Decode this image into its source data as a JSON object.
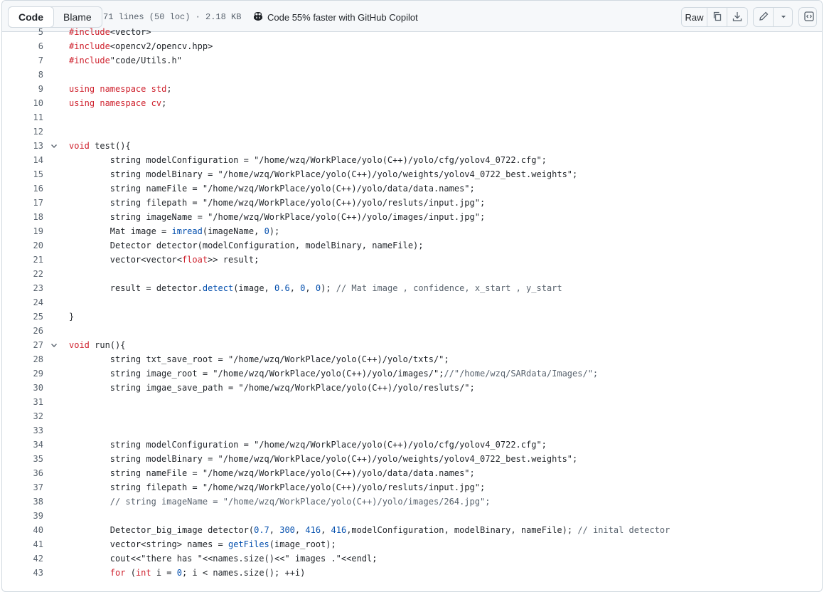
{
  "toolbar": {
    "tab_code": "Code",
    "tab_blame": "Blame",
    "file_info": "71 lines (50 loc) · 2.18 KB",
    "copilot_text": "Code 55% faster with GitHub Copilot",
    "raw_label": "Raw"
  },
  "colors": {
    "keyword": "#cf222e",
    "function": "#0550ae",
    "comment": "#59636e",
    "line_number": "#59636e"
  },
  "code_lines": [
    {
      "n": "5",
      "t": "#include<vector>"
    },
    {
      "n": "6",
      "t": "#include<opencv2/opencv.hpp>"
    },
    {
      "n": "7",
      "t": "#include\"code/Utils.h\""
    },
    {
      "n": "8",
      "t": ""
    },
    {
      "n": "9",
      "t": "using namespace std;"
    },
    {
      "n": "10",
      "t": "using namespace cv;"
    },
    {
      "n": "11",
      "t": ""
    },
    {
      "n": "12",
      "t": ""
    },
    {
      "n": "13",
      "t": "void test(){",
      "fold": true
    },
    {
      "n": "14",
      "t": "        string modelConfiguration = \"/home/wzq/WorkPlace/yolo(C++)/yolo/cfg/yolov4_0722.cfg\";"
    },
    {
      "n": "15",
      "t": "        string modelBinary = \"/home/wzq/WorkPlace/yolo(C++)/yolo/weights/yolov4_0722_best.weights\";"
    },
    {
      "n": "16",
      "t": "        string nameFile = \"/home/wzq/WorkPlace/yolo(C++)/yolo/data/data.names\";"
    },
    {
      "n": "17",
      "t": "        string filepath = \"/home/wzq/WorkPlace/yolo(C++)/yolo/resluts/input.jpg\";"
    },
    {
      "n": "18",
      "t": "        string imageName = \"/home/wzq/WorkPlace/yolo(C++)/yolo/images/input.jpg\";"
    },
    {
      "n": "19",
      "t": "        Mat image = imread(imageName, 0);"
    },
    {
      "n": "20",
      "t": "        Detector detector(modelConfiguration, modelBinary, nameFile);"
    },
    {
      "n": "21",
      "t": "        vector<vector<float>> result;"
    },
    {
      "n": "22",
      "t": ""
    },
    {
      "n": "23",
      "t": "        result = detector.detect(image, 0.6, 0, 0); // Mat image , confidence, x_start , y_start"
    },
    {
      "n": "24",
      "t": ""
    },
    {
      "n": "25",
      "t": "}"
    },
    {
      "n": "26",
      "t": ""
    },
    {
      "n": "27",
      "t": "void run(){",
      "fold": true
    },
    {
      "n": "28",
      "t": "        string txt_save_root = \"/home/wzq/WorkPlace/yolo(C++)/yolo/txts/\";"
    },
    {
      "n": "29",
      "t": "        string image_root = \"/home/wzq/WorkPlace/yolo(C++)/yolo/images/\";//\"/home/wzq/SARdata/Images/\";"
    },
    {
      "n": "30",
      "t": "        string imgae_save_path = \"/home/wzq/WorkPlace/yolo(C++)/yolo/resluts/\";"
    },
    {
      "n": "31",
      "t": ""
    },
    {
      "n": "32",
      "t": ""
    },
    {
      "n": "33",
      "t": ""
    },
    {
      "n": "34",
      "t": "        string modelConfiguration = \"/home/wzq/WorkPlace/yolo(C++)/yolo/cfg/yolov4_0722.cfg\";"
    },
    {
      "n": "35",
      "t": "        string modelBinary = \"/home/wzq/WorkPlace/yolo(C++)/yolo/weights/yolov4_0722_best.weights\";"
    },
    {
      "n": "36",
      "t": "        string nameFile = \"/home/wzq/WorkPlace/yolo(C++)/yolo/data/data.names\";"
    },
    {
      "n": "37",
      "t": "        string filepath = \"/home/wzq/WorkPlace/yolo(C++)/yolo/resluts/input.jpg\";"
    },
    {
      "n": "38",
      "t": "        // string imageName = \"/home/wzq/WorkPlace/yolo(C++)/yolo/images/264.jpg\";"
    },
    {
      "n": "39",
      "t": ""
    },
    {
      "n": "40",
      "t": "        Detector_big_image detector(0.7, 300, 416, 416,modelConfiguration, modelBinary, nameFile); // inital detector"
    },
    {
      "n": "41",
      "t": "        vector<string> names = getFiles(image_root);"
    },
    {
      "n": "42",
      "t": "        cout<<\"there has \"<<names.size()<<\" images .\"<<endl;"
    },
    {
      "n": "43",
      "t": "        for (int i = 0; i < names.size(); ++i)"
    }
  ]
}
